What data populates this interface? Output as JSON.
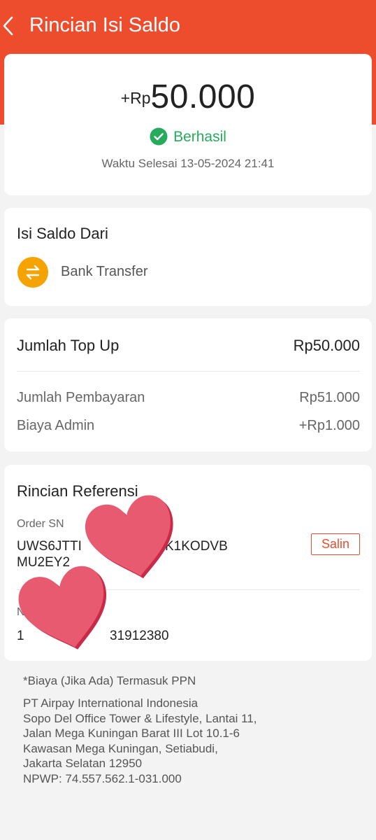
{
  "header": {
    "title": "Rincian Isi Saldo",
    "back_icon": "chevron-left-icon"
  },
  "summary": {
    "amount_prefix": "+Rp",
    "amount_value": "50.000",
    "status_icon": "check-circle-icon",
    "status_label": "Berhasil",
    "completion_time": "Waktu Selesai 13-05-2024 21:41"
  },
  "source": {
    "title": "Isi Saldo Dari",
    "method_icon": "transfer-arrows-icon",
    "method_label": "Bank Transfer"
  },
  "topup": {
    "topup_label": "Jumlah Top Up",
    "topup_value": "Rp50.000",
    "payment_label": "Jumlah Pembayaran",
    "payment_value": "Rp51.000",
    "admin_label": "Biaya Admin",
    "admin_value": "+Rp1.000"
  },
  "reference": {
    "title": "Rincian Referensi",
    "order_label": "Order SN",
    "order_value_line1": "UWS6JTTI",
    "order_value_line1_end": "K1KODVB",
    "order_value_line2": "MU2EY2",
    "copy_label": "Salin",
    "second_label": "N",
    "second_value_start": "1",
    "second_value_end": "31912380",
    "sticker_icon": "heart-sticker-icon"
  },
  "footer": {
    "note": "*Biaya (Jika Ada) Termasuk PPN",
    "company_lines": [
      "PT Airpay International Indonesia",
      "Sopo Del Office Tower & Lifestyle, Lantai 11,",
      "Jalan Mega Kuningan Barat III Lot 10.1-6",
      "Kawasan Mega Kuningan, Setiabudi,",
      "Jakarta Selatan 12950",
      "NPWP: 74.557.562.1-031.000"
    ]
  },
  "colors": {
    "brand": "#ee4d2d",
    "success": "#26aa5b",
    "bank_icon_bg": "#f5a300",
    "sticker": "#e85a70"
  }
}
